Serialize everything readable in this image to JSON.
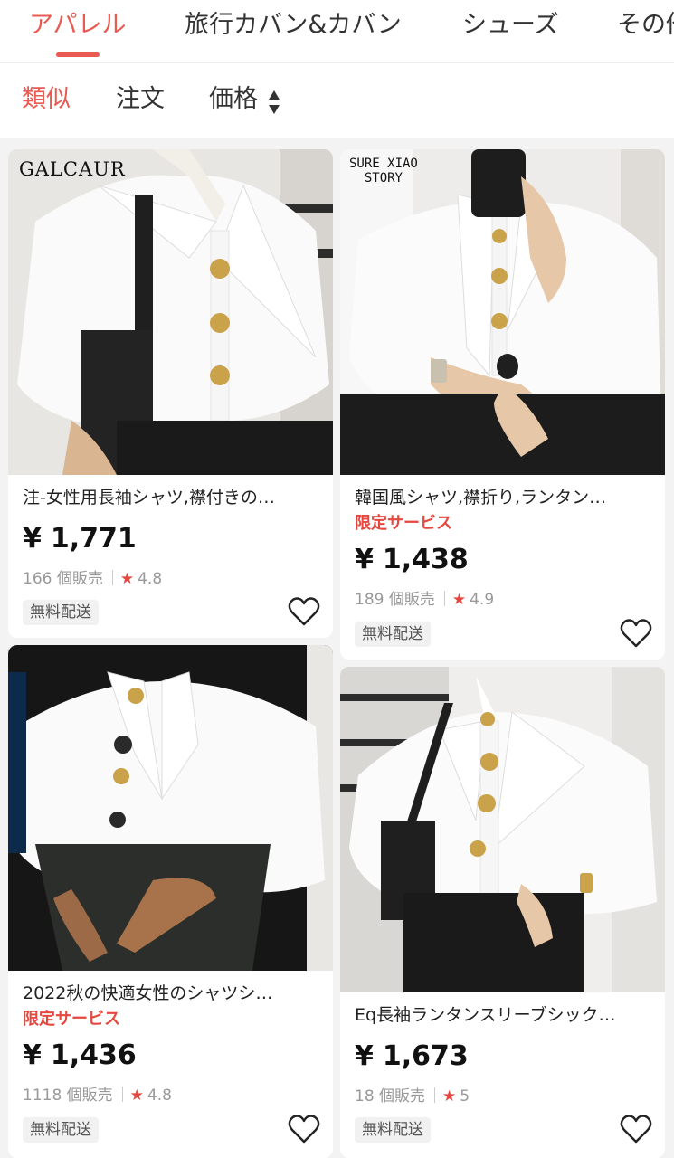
{
  "tabs": [
    {
      "label": "アパレル",
      "active": true
    },
    {
      "label": "旅行カバン&カバン",
      "active": false
    },
    {
      "label": "シューズ",
      "active": false
    },
    {
      "label": "その他",
      "active": false
    }
  ],
  "sort": {
    "similar": "類似",
    "orders": "注文",
    "price": "価格"
  },
  "products": [
    {
      "brand": "GALCAUR",
      "title": "注-女性用長袖シャツ,襟付きの…",
      "promo": "",
      "currency": "¥",
      "price": "1,771",
      "sold": "166 個販売",
      "rating": "4.8",
      "shipping": "無料配送"
    },
    {
      "brand": "SURE XIAO STORY",
      "brand_line1": "SURE XIAO",
      "brand_line2": "STORY",
      "title": "韓国風シャツ,襟折り,ランタン…",
      "promo": "限定サービス",
      "currency": "¥",
      "price": "1,438",
      "sold": "189 個販売",
      "rating": "4.9",
      "shipping": "無料配送"
    },
    {
      "brand": "",
      "title": "2022秋の快適女性のシャツシ…",
      "promo": "限定サービス",
      "currency": "¥",
      "price": "1,436",
      "sold": "1118 個販売",
      "rating": "4.8",
      "shipping": "無料配送"
    },
    {
      "brand": "",
      "title": "Eq長袖ランタンスリーブシック…",
      "promo": "",
      "currency": "¥",
      "price": "1,673",
      "sold": "18 個販売",
      "rating": "5",
      "shipping": "無料配送"
    }
  ],
  "colors": {
    "accent": "#e85a52",
    "promo": "#e5483f",
    "star": "#e5483f"
  },
  "icons": [
    "sort-arrows-icon",
    "star-icon",
    "heart-icon"
  ]
}
